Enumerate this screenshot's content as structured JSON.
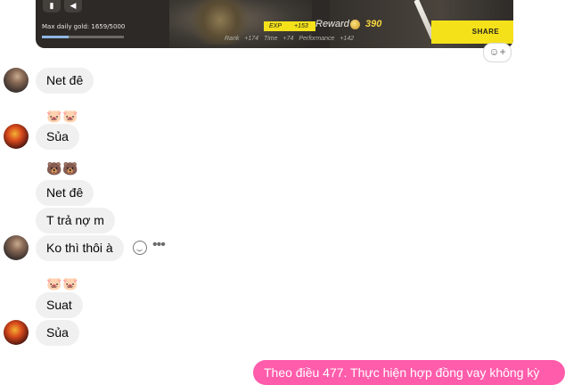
{
  "attachment": {
    "max_daily_gold": "Max daily gold: 1659/5000",
    "gold_fraction": 0.33,
    "exp_label": "EXP",
    "exp_value": "+153",
    "reward_label": "Reward",
    "reward_value": "390",
    "share_label": "SHARE",
    "rank_label": "Rank",
    "rank_value": "+174",
    "time_label": "Time",
    "time_value": "+74",
    "performance_label": "Performance",
    "performance_value": "+142",
    "mic_icon": "mic-icon",
    "speaker_icon": "speaker-icon"
  },
  "reaction_add_icon": "add-reaction-icon",
  "messages": [
    {
      "text": "Net đê",
      "sender": "a"
    },
    {
      "reaction": "🐷🐷",
      "text": "Sủa",
      "sender": "b"
    },
    {
      "reaction": "🐻🐻",
      "text": "Net đê",
      "sender": "a"
    },
    {
      "text": "T trả nợ m",
      "sender": "a"
    },
    {
      "text": "Ko thì thôi à",
      "sender": "a"
    },
    {
      "reaction": "🐷🐷",
      "text": "Suat",
      "sender": "b"
    },
    {
      "text": "Sủa",
      "sender": "b"
    },
    {
      "text": "Theo điều 477. Thực hiện hợp đồng vay không kỳ",
      "sender": "me"
    }
  ],
  "colors": {
    "incoming_bubble": "#f0f0f0",
    "outgoing_bubble": "#ff5cab",
    "accent_yellow": "#f5e11a"
  }
}
